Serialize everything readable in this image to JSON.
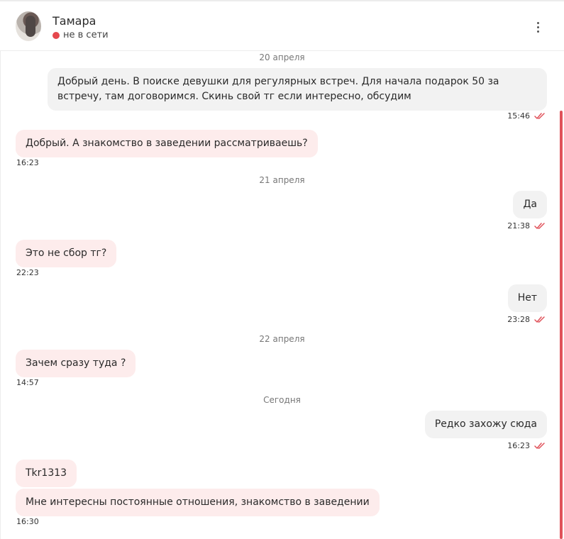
{
  "header": {
    "name": "Тамара",
    "status": "не в сети",
    "status_color": "#e5484d"
  },
  "accent": "#e0525a",
  "messages": [
    {
      "date": "20 апреля"
    },
    {
      "dir": "out",
      "text": "Добрый день. В поиске девушки для регулярных встреч. Для начала подарок 50 за встречу, там договоримся. Скинь свой тг если интересно, обсудим",
      "time": "15:46"
    },
    {
      "dir": "in",
      "text": "Добрый. А знакомство в заведении рассматриваешь?",
      "time": "16:23"
    },
    {
      "date": "21 апреля"
    },
    {
      "dir": "out",
      "text": "Да",
      "time": "21:38"
    },
    {
      "dir": "in",
      "text": "Это не сбор тг?",
      "time": "22:23"
    },
    {
      "dir": "out",
      "text": "Нет",
      "time": "23:28"
    },
    {
      "date": "22 апреля"
    },
    {
      "dir": "in",
      "text": "Зачем сразу туда ?",
      "time": "14:57"
    },
    {
      "date": "Сегодня"
    },
    {
      "dir": "out",
      "text": "Редко захожу сюда",
      "time": "16:23"
    },
    {
      "dir": "in",
      "text": "Tkr1313"
    },
    {
      "dir": "in",
      "text": "Мне интересны постоянные отношения, знакомство в заведении",
      "time": "16:30"
    }
  ]
}
